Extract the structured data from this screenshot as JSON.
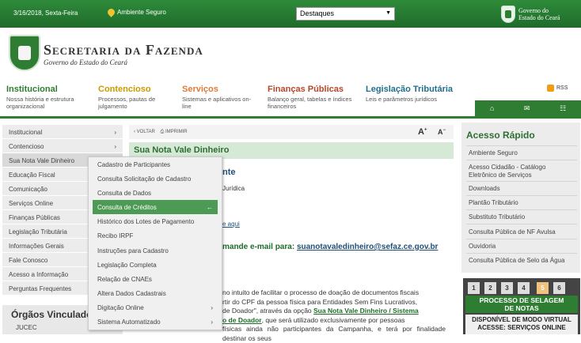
{
  "topbar": {
    "date": "3/16/2018, Sexta-Feira",
    "ambiente": "Ambiente Seguro",
    "select_value": "Destaques",
    "gov_line1": "Governo do",
    "gov_line2": "Estado do Ceará"
  },
  "header": {
    "title": "Secretaria da Fazenda",
    "subtitle": "Governo do Estado do Ceará"
  },
  "main_menu": [
    {
      "label": "Institucional",
      "desc": "Nossa história e estrutura organizacional",
      "color": "#2e7d32"
    },
    {
      "label": "Contencioso",
      "desc": "Processos, pautas de julgamento",
      "color": "#c99a00"
    },
    {
      "label": "Serviços",
      "desc": "Sistemas e aplicativos on-line",
      "color": "#e07b39"
    },
    {
      "label": "Finanças Públicas",
      "desc": "Balanço geral, tabelas e índices financeiros",
      "color": "#b7472a"
    },
    {
      "label": "Legislação Tributária",
      "desc": "Leis e parâmetros jurídicos",
      "color": "#1f6f8b"
    }
  ],
  "rss": "RSS",
  "sidebar": [
    {
      "label": "Institucional",
      "arrow": "›"
    },
    {
      "label": "Contencioso",
      "arrow": "›"
    },
    {
      "label": "Sua Nota Vale Dinheiro",
      "arrow": ""
    },
    {
      "label": "Educação Fiscal",
      "arrow": ""
    },
    {
      "label": "Comunicação",
      "arrow": ""
    },
    {
      "label": "Serviços Online",
      "arrow": ""
    },
    {
      "label": "Finanças Públicas",
      "arrow": ""
    },
    {
      "label": "Legislação Tributária",
      "arrow": ""
    },
    {
      "label": "Informações Gerais",
      "arrow": ""
    },
    {
      "label": "Fale Conosco",
      "arrow": ""
    },
    {
      "label": "Acesso a Informação",
      "arrow": ""
    },
    {
      "label": "Perguntas Frequentes",
      "arrow": ""
    }
  ],
  "orgaos": {
    "title": "Órgãos Vinculados",
    "item": "JUCEC"
  },
  "dropdown": [
    {
      "label": "Cadastro de Participantes",
      "arrow": ""
    },
    {
      "label": "Consulta Solicitação de Cadastro",
      "arrow": ""
    },
    {
      "label": "Consulta de Dados",
      "arrow": ""
    },
    {
      "label": "Consulta de Créditos",
      "arrow": "←"
    },
    {
      "label": "Histórico dos Lotes de Pagamento",
      "arrow": ""
    },
    {
      "label": "Recibo IRPF",
      "arrow": ""
    },
    {
      "label": "Instruções para Cadastro",
      "arrow": ""
    },
    {
      "label": "Legislação Completa",
      "arrow": ""
    },
    {
      "label": "Relação de CNAEs",
      "arrow": ""
    },
    {
      "label": "Altera Dados Cadastrais",
      "arrow": ""
    },
    {
      "label": "Digitação Online",
      "arrow": "›"
    },
    {
      "label": "Sistema Automatizado",
      "arrow": "›"
    }
  ],
  "tools": {
    "voltar": "VOLTAR",
    "imprimir": "IMPRIMIR",
    "font_up": "A",
    "font_down": "A"
  },
  "content": {
    "page_title": "Sua Nota Vale Dinheiro",
    "sub_heading": "nte",
    "line_juridica": "Jurídica",
    "line_aqui": "e aqui",
    "email_prefix": "mande e-mail para:",
    "email": "suanotavaledinheiro@sefaz.ce.gov.br",
    "p1": "no intuito de facilitar o processo de doação de documentos fiscais",
    "p2": "rtir do CPF da pessoa física para Entidades Sem Fins Lucrativos,",
    "p3a": "de Doador\", através da opção ",
    "p3link": "Sua Nota Vale Dinheiro / Sistema",
    "p4link": "o de Doador",
    "p4b": ", que será utilizado exclusivamente por pessoas",
    "p5": "físicas ainda não participantes da Campanha, e terá por finalidade destinar os seus"
  },
  "right": {
    "title": "Acesso Rápido",
    "items": [
      "Ambiente Seguro",
      "Acesso Cidadão - Catálogo Eletrônico de Serviços",
      "Downloads",
      "Plantão Tributário",
      "Substituto Tributário",
      "Consulta Pública de NF Avulsa",
      "Ouvidoria",
      "Consulta Pública de Selo da Água"
    ]
  },
  "banner": {
    "numbers": [
      "1",
      "2",
      "3",
      "4",
      "5",
      "6"
    ],
    "selected": "5",
    "green_l1": "PROCESSO DE SELAGEM",
    "green_l2": "DE NOTAS",
    "white_l1": "DISPONÍVEL DE MODO VIRTUAL",
    "white_l2": "ACESSE: SERVIÇOS ONLINE"
  }
}
